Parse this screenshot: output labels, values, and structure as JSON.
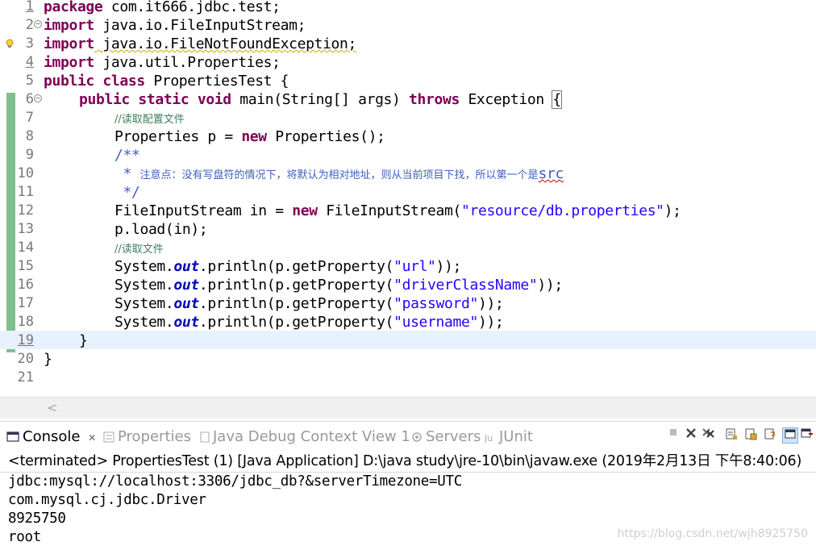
{
  "editor": {
    "line_numbers": [
      "1",
      "2",
      "3",
      "4",
      "5",
      "6",
      "7",
      "8",
      "9",
      "10",
      "11",
      "12",
      "13",
      "14",
      "15",
      "16",
      "17",
      "18",
      "19",
      "20",
      "21"
    ],
    "lines": {
      "l1": {
        "kw": "package",
        "rest": " com.it666.jdbc.test;"
      },
      "l2": {
        "kw": "import",
        "rest": " java.io.FileInputStream;"
      },
      "l3": {
        "kw": "import",
        "rest": " java.io.FileNotFoundException;"
      },
      "l4": {
        "kw": "import",
        "rest": " java.util.Properties;"
      },
      "l5": {
        "kw1": "public",
        "kw2": "class",
        "rest": " PropertiesTest {"
      },
      "l6": {
        "kw1": "public",
        "kw2": "static",
        "kw3": "void",
        "mid": " main(String[] args) ",
        "kw4": "throws",
        "rest": " Exception ",
        "brace": "{"
      },
      "l7": {
        "comment": "//读取配置文件"
      },
      "l8": {
        "pre": "Properties p = ",
        "kw": "new",
        "rest": " Properties();"
      },
      "l9": {
        "jdoc": "/**"
      },
      "l10": {
        "star": " * ",
        "text": "注意点：没有写盘符的情况下，将默认为相对地址，则从当前项目下找，所以第一个是",
        "tail": "src"
      },
      "l11": {
        "jdoc": " */"
      },
      "l12": {
        "pre": "FileInputStream in = ",
        "kw": "new",
        "mid": " FileInputStream(",
        "str": "\"resource/db.properties\"",
        "rest": ");"
      },
      "l13": {
        "text": "p.load(in);"
      },
      "l14": {
        "comment": "//读取文件"
      },
      "l15": {
        "pre": "System.",
        "fld": "out",
        "mid": ".println(p.getProperty(",
        "str": "\"url\"",
        "rest": "));"
      },
      "l16": {
        "pre": "System.",
        "fld": "out",
        "mid": ".println(p.getProperty(",
        "str": "\"driverClassName\"",
        "rest": "));"
      },
      "l17": {
        "pre": "System.",
        "fld": "out",
        "mid": ".println(p.getProperty(",
        "str": "\"password\"",
        "rest": "));"
      },
      "l18": {
        "pre": "System.",
        "fld": "out",
        "mid": ".println(p.getProperty(",
        "str": "\"username\"",
        "rest": "));"
      },
      "l19": {
        "text": "}"
      },
      "l20": {
        "text": "}"
      }
    },
    "scroll_left_glyph": "<"
  },
  "console": {
    "tabs": [
      {
        "label": "Console",
        "close": "✕",
        "icon": "console-icon"
      },
      {
        "label": "Properties",
        "icon": "properties-icon"
      },
      {
        "label": "Java Debug Context View 1",
        "icon": "debug-context-icon"
      },
      {
        "label": "Servers",
        "icon": "servers-icon"
      },
      {
        "label": "JUnit",
        "icon": "junit-icon"
      }
    ],
    "status": "<terminated> PropertiesTest (1) [Java Application] D:\\java study\\jre-10\\bin\\javaw.exe (2019年2月13日 下午8:40:06)",
    "output": [
      "jdbc:mysql://localhost:3306/jdbc_db?&serverTimezone=UTC",
      "com.mysql.cj.jdbc.Driver",
      "8925750",
      "root"
    ],
    "watermark": "https://blog.csdn.net/wjh8925750"
  },
  "colors": {
    "keyword": "#7f0055",
    "string": "#2a00ff",
    "comment": "#3f7f5f",
    "javadoc": "#3f5fbf",
    "field": "#0000c0",
    "current_line": "#e8f2fe",
    "quick_diff": "#7fbf8f"
  }
}
